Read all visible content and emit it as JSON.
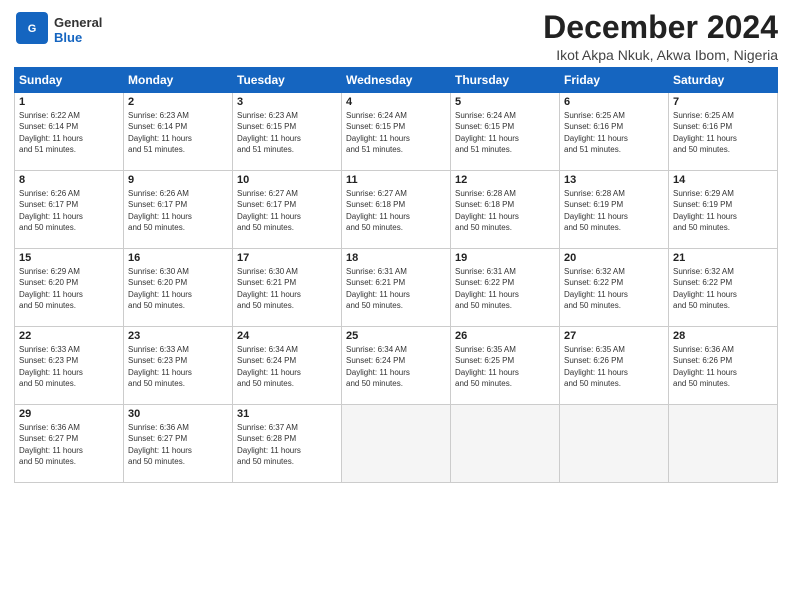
{
  "header": {
    "logo_general": "General",
    "logo_blue": "Blue",
    "month_title": "December 2024",
    "location": "Ikot Akpa Nkuk, Akwa Ibom, Nigeria"
  },
  "days_of_week": [
    "Sunday",
    "Monday",
    "Tuesday",
    "Wednesday",
    "Thursday",
    "Friday",
    "Saturday"
  ],
  "weeks": [
    [
      {
        "day": "1",
        "info": "Sunrise: 6:22 AM\nSunset: 6:14 PM\nDaylight: 11 hours\nand 51 minutes."
      },
      {
        "day": "2",
        "info": "Sunrise: 6:23 AM\nSunset: 6:14 PM\nDaylight: 11 hours\nand 51 minutes."
      },
      {
        "day": "3",
        "info": "Sunrise: 6:23 AM\nSunset: 6:15 PM\nDaylight: 11 hours\nand 51 minutes."
      },
      {
        "day": "4",
        "info": "Sunrise: 6:24 AM\nSunset: 6:15 PM\nDaylight: 11 hours\nand 51 minutes."
      },
      {
        "day": "5",
        "info": "Sunrise: 6:24 AM\nSunset: 6:15 PM\nDaylight: 11 hours\nand 51 minutes."
      },
      {
        "day": "6",
        "info": "Sunrise: 6:25 AM\nSunset: 6:16 PM\nDaylight: 11 hours\nand 51 minutes."
      },
      {
        "day": "7",
        "info": "Sunrise: 6:25 AM\nSunset: 6:16 PM\nDaylight: 11 hours\nand 50 minutes."
      }
    ],
    [
      {
        "day": "8",
        "info": "Sunrise: 6:26 AM\nSunset: 6:17 PM\nDaylight: 11 hours\nand 50 minutes."
      },
      {
        "day": "9",
        "info": "Sunrise: 6:26 AM\nSunset: 6:17 PM\nDaylight: 11 hours\nand 50 minutes."
      },
      {
        "day": "10",
        "info": "Sunrise: 6:27 AM\nSunset: 6:17 PM\nDaylight: 11 hours\nand 50 minutes."
      },
      {
        "day": "11",
        "info": "Sunrise: 6:27 AM\nSunset: 6:18 PM\nDaylight: 11 hours\nand 50 minutes."
      },
      {
        "day": "12",
        "info": "Sunrise: 6:28 AM\nSunset: 6:18 PM\nDaylight: 11 hours\nand 50 minutes."
      },
      {
        "day": "13",
        "info": "Sunrise: 6:28 AM\nSunset: 6:19 PM\nDaylight: 11 hours\nand 50 minutes."
      },
      {
        "day": "14",
        "info": "Sunrise: 6:29 AM\nSunset: 6:19 PM\nDaylight: 11 hours\nand 50 minutes."
      }
    ],
    [
      {
        "day": "15",
        "info": "Sunrise: 6:29 AM\nSunset: 6:20 PM\nDaylight: 11 hours\nand 50 minutes."
      },
      {
        "day": "16",
        "info": "Sunrise: 6:30 AM\nSunset: 6:20 PM\nDaylight: 11 hours\nand 50 minutes."
      },
      {
        "day": "17",
        "info": "Sunrise: 6:30 AM\nSunset: 6:21 PM\nDaylight: 11 hours\nand 50 minutes."
      },
      {
        "day": "18",
        "info": "Sunrise: 6:31 AM\nSunset: 6:21 PM\nDaylight: 11 hours\nand 50 minutes."
      },
      {
        "day": "19",
        "info": "Sunrise: 6:31 AM\nSunset: 6:22 PM\nDaylight: 11 hours\nand 50 minutes."
      },
      {
        "day": "20",
        "info": "Sunrise: 6:32 AM\nSunset: 6:22 PM\nDaylight: 11 hours\nand 50 minutes."
      },
      {
        "day": "21",
        "info": "Sunrise: 6:32 AM\nSunset: 6:22 PM\nDaylight: 11 hours\nand 50 minutes."
      }
    ],
    [
      {
        "day": "22",
        "info": "Sunrise: 6:33 AM\nSunset: 6:23 PM\nDaylight: 11 hours\nand 50 minutes."
      },
      {
        "day": "23",
        "info": "Sunrise: 6:33 AM\nSunset: 6:23 PM\nDaylight: 11 hours\nand 50 minutes."
      },
      {
        "day": "24",
        "info": "Sunrise: 6:34 AM\nSunset: 6:24 PM\nDaylight: 11 hours\nand 50 minutes."
      },
      {
        "day": "25",
        "info": "Sunrise: 6:34 AM\nSunset: 6:24 PM\nDaylight: 11 hours\nand 50 minutes."
      },
      {
        "day": "26",
        "info": "Sunrise: 6:35 AM\nSunset: 6:25 PM\nDaylight: 11 hours\nand 50 minutes."
      },
      {
        "day": "27",
        "info": "Sunrise: 6:35 AM\nSunset: 6:26 PM\nDaylight: 11 hours\nand 50 minutes."
      },
      {
        "day": "28",
        "info": "Sunrise: 6:36 AM\nSunset: 6:26 PM\nDaylight: 11 hours\nand 50 minutes."
      }
    ],
    [
      {
        "day": "29",
        "info": "Sunrise: 6:36 AM\nSunset: 6:27 PM\nDaylight: 11 hours\nand 50 minutes."
      },
      {
        "day": "30",
        "info": "Sunrise: 6:36 AM\nSunset: 6:27 PM\nDaylight: 11 hours\nand 50 minutes."
      },
      {
        "day": "31",
        "info": "Sunrise: 6:37 AM\nSunset: 6:28 PM\nDaylight: 11 hours\nand 50 minutes."
      },
      {
        "day": "",
        "info": ""
      },
      {
        "day": "",
        "info": ""
      },
      {
        "day": "",
        "info": ""
      },
      {
        "day": "",
        "info": ""
      }
    ]
  ]
}
